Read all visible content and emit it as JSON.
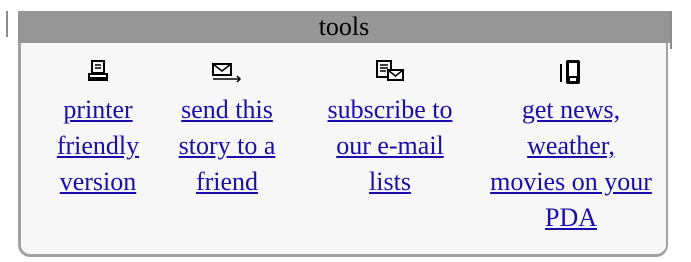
{
  "tools_panel": {
    "title": "tools",
    "items": [
      {
        "icon": "printer-icon",
        "lines": [
          "printer",
          "friendly",
          "version"
        ]
      },
      {
        "icon": "email-send-icon",
        "lines": [
          "send this",
          "story to a",
          "friend"
        ]
      },
      {
        "icon": "newsletter-icon",
        "lines": [
          "subscribe to",
          "our e-mail",
          "lists"
        ]
      },
      {
        "icon": "pda-icon",
        "lines": [
          "get news,",
          "weather,",
          "movies on your",
          "PDA"
        ]
      }
    ]
  }
}
